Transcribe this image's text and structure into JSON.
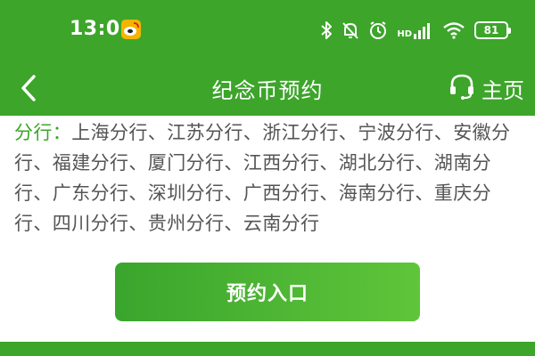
{
  "status_bar": {
    "time": "13:01",
    "network_label": "HD",
    "battery_level": "81",
    "icons": [
      "weibo-icon",
      "bluetooth-icon",
      "mute-icon",
      "alarm-icon",
      "signal-icon",
      "wifi-icon",
      "battery-icon"
    ]
  },
  "header": {
    "title": "纪念币预约",
    "home_label": "主页",
    "back_icon": "chevron-left-icon",
    "home_icon": "headset-icon"
  },
  "content": {
    "branch_prefix": "分行：",
    "branch_list": "上海分行、江苏分行、浙江分行、宁波分行、安徽分行、福建分行、厦门分行、江西分行、湖北分行、湖南分行、广东分行、深圳分行、广西分行、海南分行、重庆分行、四川分行、贵州分行、云南分行"
  },
  "actions": {
    "reserve_label": "预约入口"
  },
  "colors": {
    "brand_green": "#3ca52a",
    "button_gradient_end": "#5fc53a",
    "body_text": "#555555"
  }
}
